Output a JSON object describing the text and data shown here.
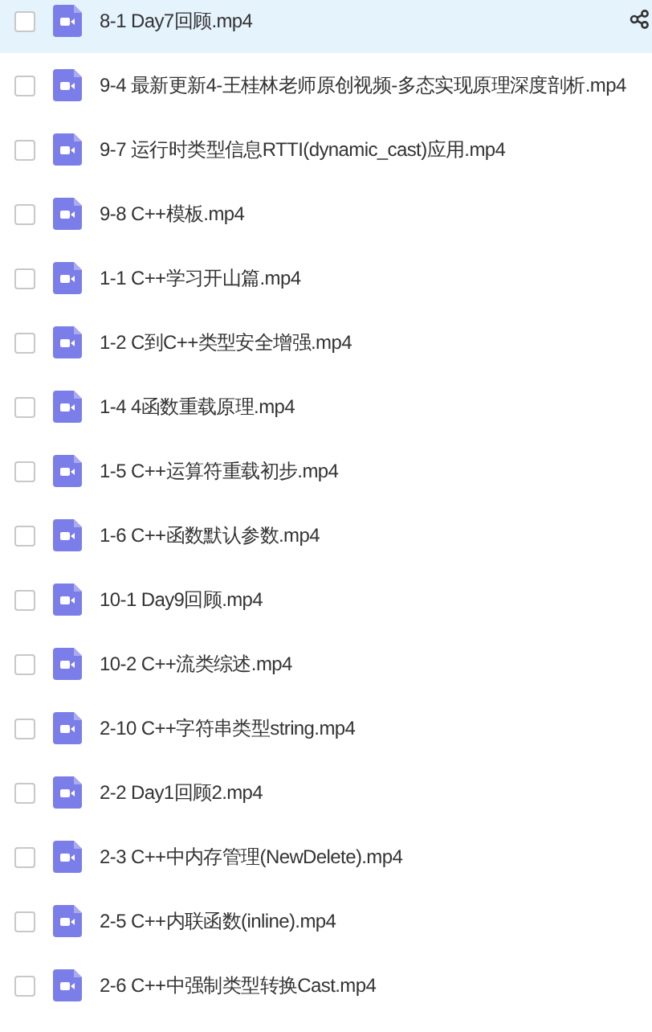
{
  "files": [
    {
      "name": "8-1 Day7回顾.mp4",
      "checked": false,
      "highlighted": true
    },
    {
      "name": "9-4 最新更新4-王桂林老师原创视频-多态实现原理深度剖析.mp4",
      "checked": false,
      "highlighted": false
    },
    {
      "name": "9-7 运行时类型信息RTTI(dynamic_cast)应用.mp4",
      "checked": false,
      "highlighted": false
    },
    {
      "name": "9-8 C++模板.mp4",
      "checked": false,
      "highlighted": false
    },
    {
      "name": "1-1 C++学习开山篇.mp4",
      "checked": false,
      "highlighted": false
    },
    {
      "name": "1-2 C到C++类型安全增强.mp4",
      "checked": false,
      "highlighted": false
    },
    {
      "name": "1-4 4函数重载原理.mp4",
      "checked": false,
      "highlighted": false
    },
    {
      "name": "1-5 C++运算符重载初步.mp4",
      "checked": false,
      "highlighted": false
    },
    {
      "name": "1-6 C++函数默认参数.mp4",
      "checked": false,
      "highlighted": false
    },
    {
      "name": "10-1 Day9回顾.mp4",
      "checked": false,
      "highlighted": false
    },
    {
      "name": "10-2 C++流类综述.mp4",
      "checked": false,
      "highlighted": false
    },
    {
      "name": "2-10 C++字符串类型string.mp4",
      "checked": false,
      "highlighted": false
    },
    {
      "name": "2-2 Day1回顾2.mp4",
      "checked": false,
      "highlighted": false
    },
    {
      "name": "2-3 C++中内存管理(NewDelete).mp4",
      "checked": false,
      "highlighted": false
    },
    {
      "name": "2-5 C++内联函数(inline).mp4",
      "checked": false,
      "highlighted": false
    },
    {
      "name": "2-6 C++中强制类型转换Cast.mp4",
      "checked": false,
      "highlighted": false
    }
  ]
}
